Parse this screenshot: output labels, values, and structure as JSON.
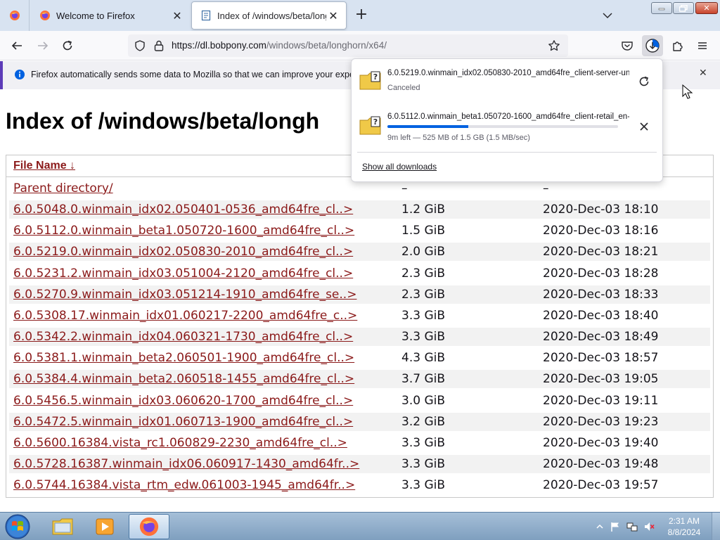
{
  "browser": {
    "tabs": [
      {
        "title": "Welcome to Firefox",
        "active": false
      },
      {
        "title": "Index of /windows/beta/longho",
        "active": true
      }
    ],
    "url_host": "https://dl.bobpony.com",
    "url_path": "/windows/beta/longhorn/x64/"
  },
  "notification": {
    "text": "Firefox automatically sends some data to Mozilla so that we can improve your experien"
  },
  "page": {
    "title": "Index of /windows/beta/longh",
    "column_header": "File Name  ↓",
    "rows": [
      {
        "name": "Parent directory/",
        "size": "–",
        "date": "–"
      },
      {
        "name": "6.0.5048.0.winmain_idx02.050401-0536_amd64fre_cl..>",
        "size": "1.2 GiB",
        "date": "2020-Dec-03 18:10"
      },
      {
        "name": "6.0.5112.0.winmain_beta1.050720-1600_amd64fre_cl..>",
        "size": "1.5 GiB",
        "date": "2020-Dec-03 18:16"
      },
      {
        "name": "6.0.5219.0.winmain_idx02.050830-2010_amd64fre_cl..>",
        "size": "2.0 GiB",
        "date": "2020-Dec-03 18:21"
      },
      {
        "name": "6.0.5231.2.winmain_idx03.051004-2120_amd64fre_cl..>",
        "size": "2.3 GiB",
        "date": "2020-Dec-03 18:28"
      },
      {
        "name": "6.0.5270.9.winmain_idx03.051214-1910_amd64fre_se..>",
        "size": "2.3 GiB",
        "date": "2020-Dec-03 18:33"
      },
      {
        "name": "6.0.5308.17.winmain_idx01.060217-2200_amd64fre_c..>",
        "size": "3.3 GiB",
        "date": "2020-Dec-03 18:40"
      },
      {
        "name": "6.0.5342.2.winmain_idx04.060321-1730_amd64fre_cl..>",
        "size": "3.3 GiB",
        "date": "2020-Dec-03 18:49"
      },
      {
        "name": "6.0.5381.1.winmain_beta2.060501-1900_amd64fre_cl..>",
        "size": "4.3 GiB",
        "date": "2020-Dec-03 18:57"
      },
      {
        "name": "6.0.5384.4.winmain_beta2.060518-1455_amd64fre_cl..>",
        "size": "3.7 GiB",
        "date": "2020-Dec-03 19:05"
      },
      {
        "name": "6.0.5456.5.winmain_idx03.060620-1700_amd64fre_cl..>",
        "size": "3.0 GiB",
        "date": "2020-Dec-03 19:11"
      },
      {
        "name": "6.0.5472.5.winmain_idx01.060713-1900_amd64fre_cl..>",
        "size": "3.2 GiB",
        "date": "2020-Dec-03 19:23"
      },
      {
        "name": "6.0.5600.16384.vista_rc1.060829-2230_amd64fre_cl..>",
        "size": "3.3 GiB",
        "date": "2020-Dec-03 19:40"
      },
      {
        "name": "6.0.5728.16387.winmain_idx06.060917-1430_amd64fr..>",
        "size": "3.3 GiB",
        "date": "2020-Dec-03 19:48"
      },
      {
        "name": "6.0.5744.16384.vista_rtm_edw.061003-1945_amd64fr..>",
        "size": "3.3 GiB",
        "date": "2020-Dec-03 19:57"
      }
    ]
  },
  "downloads": {
    "items": [
      {
        "name": "6.0.5219.0.winmain_idx02.050830-2010_amd64fre_client-server-un",
        "status": "Canceled",
        "action_icon": "retry-icon"
      },
      {
        "name": "6.0.5112.0.winmain_beta1.050720-1600_amd64fre_client-retail_en-",
        "status": "9m left — 525 MB of 1.5 GB (1.5 MB/sec)",
        "action_icon": "cancel-icon",
        "progress": 0.35
      }
    ],
    "show_all": "Show all downloads"
  },
  "taskbar": {
    "time": "2:31 AM",
    "date": "8/8/2024"
  },
  "colors": {
    "link": "#8b1a1a",
    "accent": "#0061e0",
    "notice_accent": "#5c3bb8"
  }
}
